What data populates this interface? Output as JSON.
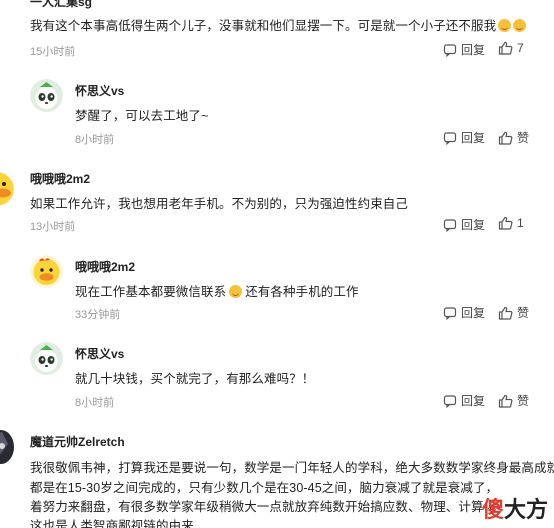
{
  "comments": [
    {
      "id": "c1",
      "author": "一人汇集sg",
      "text": "我有这个本事高低得生两个儿子，没事就和他们显摆一下。可是就一个小子还不服我",
      "time": "15小时前",
      "reply_label": "回复",
      "likes": "7"
    },
    {
      "id": "r1",
      "author": "怀思义vs",
      "text": "梦醒了，可以去工地了~",
      "time": "8小时前",
      "reply_label": "回复",
      "likes": "赞"
    },
    {
      "id": "c2",
      "author": "哦哦哦2m2",
      "text": "如果工作允许，我也想用老年手机。不为别的，只为强迫性约束自己",
      "time": "13小时前",
      "reply_label": "回复",
      "likes": "1"
    },
    {
      "id": "r2",
      "author": "哦哦哦2m2",
      "text_before": "现在工作基本都要微信联系",
      "text_after": "还有各种手机的工作",
      "time": "33分钟前",
      "reply_label": "回复",
      "likes": "赞"
    },
    {
      "id": "r3",
      "author": "怀思义vs",
      "text": "就几十块钱，买个就完了，有那么难吗？！",
      "time": "8小时前",
      "reply_label": "回复",
      "likes": "赞"
    },
    {
      "id": "c3",
      "author": "魔道元帅Zelretch",
      "lines": [
        "我很敬佩韦神，打算我还是要说一句，数学是一门年轻人的学科，绝大多数数学家终身最高成就",
        "都是在15-30岁之间完成的，只有少数几个是在30-45之间，脑力衰减了就是衰减了，",
        "着努力来翻盘，有很多数学家年级稍微大一点就放弃纯数开始搞应数、物理、计算化",
        "这也是人类智商鄙视链的由来"
      ]
    }
  ],
  "watermark": {
    "char1": "傻",
    "rest": "大方"
  },
  "colors": {
    "text": "#222222",
    "muted": "#999999",
    "watermark_accent": "#e03b2e"
  }
}
